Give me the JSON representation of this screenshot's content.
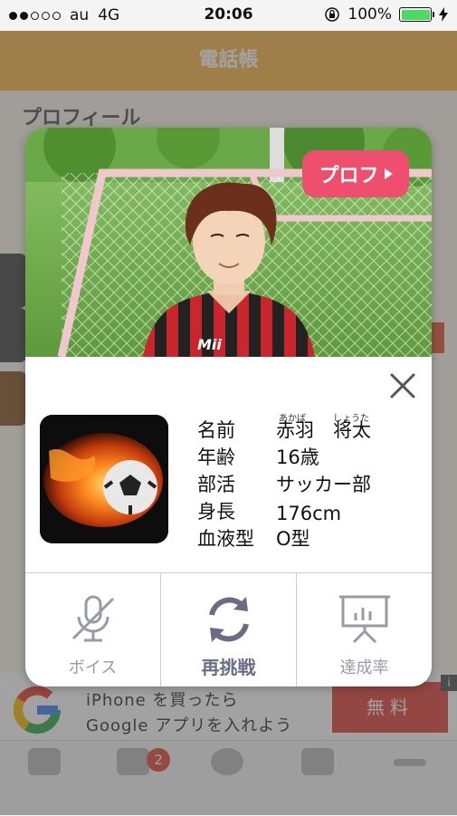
{
  "status": {
    "carrier": "au",
    "network": "4G",
    "time": "20:06",
    "battery": "100%"
  },
  "app": {
    "nav_title": "電話帳",
    "section_title": "プロフィール"
  },
  "ad": {
    "line1": "iPhone を買ったら",
    "line2": "Google アプリを入れよう",
    "button": "無料",
    "info": "i"
  },
  "tabbar": {
    "badge_count": "2"
  },
  "modal": {
    "prof_button": "プロフ",
    "profile": {
      "name_label": "名前",
      "name_value": "赤羽　将太",
      "name_ruby_1": "あかば",
      "name_ruby_2": "しょうた",
      "age_label": "年齢",
      "age_value": "16歳",
      "club_label": "部活",
      "club_value": "サッカー部",
      "height_label": "身長",
      "height_value": "176cm",
      "blood_label": "血液型",
      "blood_value": "O型"
    },
    "actions": {
      "voice": "ボイス",
      "retry": "再挑戦",
      "achievement": "達成率"
    }
  },
  "colors": {
    "accent_pink": "#ef4f6f",
    "nav_orange": "#f6b94e",
    "icon_gray": "#9a9aa6",
    "icon_dark": "#6b6b85"
  }
}
